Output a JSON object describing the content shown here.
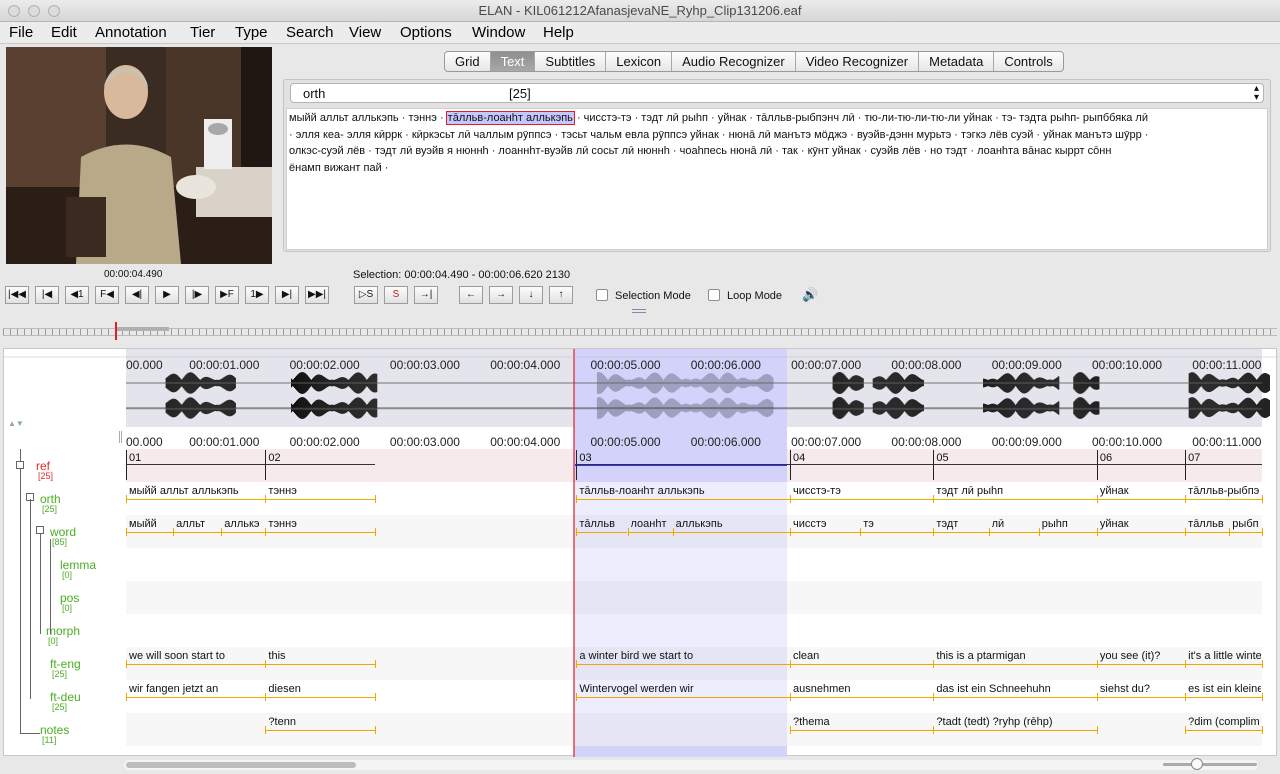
{
  "window": {
    "title": "ELAN - KIL061212AfanasjevaNE_Ryhp_Clip131206.eaf"
  },
  "menu": [
    "File",
    "Edit",
    "Annotation",
    "Tier",
    "Type",
    "Search",
    "View",
    "Options",
    "Window",
    "Help"
  ],
  "media": {
    "current_time": "00:00:04.490",
    "selection": "Selection: 00:00:04.490 - 00:00:06.620  2130"
  },
  "tabs": [
    "Grid",
    "Text",
    "Subtitles",
    "Lexicon",
    "Audio Recognizer",
    "Video Recognizer",
    "Metadata",
    "Controls"
  ],
  "active_tab": "Text",
  "text_view": {
    "tier": "orth",
    "count": "[25]",
    "lines": [
      [
        "мыйй алльт аллькэпь",
        "·",
        "тэннэ",
        "·"
      ],
      [],
      [],
      [
        "ёнамп вижант пай",
        "·"
      ]
    ],
    "line1_after": "·  чисстэ-тэ  ·  тэдт лӣ рыhп  ·  уйнак  ·  тāлльв-рыбпэнч лӣ  ·  тю-ли-тю-ли-тю-ли уйнак  ·  тэ- тэдта рыhп- рыпббяка лӣ",
    "line1_selected": "тāлльв-лоанһт аллькэпь",
    "line2": "·  элля кеа- элля кӣррк  ·  кӣркэсьт лӣ чаллым рӯппсэ  ·  тэсьт чальм евла рӯппсэ уйнак  ·  нюнā лӣ манътэ мӧджэ  ·  вуэйв-дэнн мурьтэ  ·  тэгкэ лёв  суэй  ·  уйнак манътэ шӯрр  ·",
    "line3": "олкэс-суэй лёв  ·  тэдт лӣ вуэйв я нюннһ  ·  лоаннһт-вуэйв лӣ сосьт лӣ нюннһ  ·  чоаhпесь нюнā лӣ  ·  так  ·  кӯнт уйнак  ·  суэйв лёв  ·  но тэдт  ·  лоанһта вāнас кыррт сōнн",
    "line4": "ёнамп вижант пай  ·"
  },
  "controls": {
    "selection_mode_label": "Selection Mode",
    "loop_mode_label": "Loop Mode"
  },
  "ruler": [
    "00.000",
    "00:00:01.000",
    "00:00:02.000",
    "00:00:03.000",
    "00:00:04.000",
    "00:00:05.000",
    "00:00:06.000",
    "00:00:07.000",
    "00:00:08.000",
    "00:00:09.000",
    "00:00:10.000",
    "00:00:11.000"
  ],
  "tiers": [
    {
      "name": "ref",
      "count": "[25]",
      "color": "#e02a2a"
    },
    {
      "name": "orth",
      "count": "[25]",
      "color": "#4bae22"
    },
    {
      "name": "word",
      "count": "[85]",
      "color": "#4bae22"
    },
    {
      "name": "lemma",
      "count": "[0]",
      "color": "#4bae22"
    },
    {
      "name": "pos",
      "count": "[0]",
      "color": "#4bae22"
    },
    {
      "name": "morph",
      "count": "[0]",
      "color": "#4bae22"
    },
    {
      "name": "ft-eng",
      "count": "[25]",
      "color": "#4bae22"
    },
    {
      "name": "ft-deu",
      "count": "[25]",
      "color": "#4bae22"
    },
    {
      "name": "notes",
      "count": "[11]",
      "color": "#4bae22"
    }
  ],
  "annotations": {
    "ref": [
      "01",
      "02",
      "03",
      "04",
      "05",
      "06",
      "07"
    ],
    "orth": [
      "мыйй алльт аллькэпь",
      "тэннэ",
      "тāлльв-лоанһт аллькэпь",
      "чисстэ-тэ",
      "тэдт лӣ рыhп",
      "уйнак",
      "тāлльв-рыбпэ"
    ],
    "word": [
      "мыйй",
      "алльт",
      "аллькэ",
      "тэннэ",
      "тāлльв",
      "лоанһт",
      "аллькэпь",
      "чисстэ",
      "тэ",
      "тэдт",
      "лӣ",
      "рыhп",
      "уйнак",
      "тāлльв",
      "рыбп"
    ],
    "ft-eng": [
      "we will soon start to",
      "this",
      "a winter bird we start to",
      "clean",
      "this is a ptarmigan",
      "you see (it)?",
      "it's a little winter"
    ],
    "ft-deu": [
      "wir fangen jetzt an",
      "diesen",
      "Wintervogel werden wir",
      "ausnehmen",
      "das ist ein Schneehuhn",
      "siehst du?",
      "es ist ein kleine"
    ],
    "notes": [
      "?tenn",
      "?thema",
      "?tadt (tedt) ?ryhp (rēhp)",
      "?dim (complim"
    ]
  }
}
